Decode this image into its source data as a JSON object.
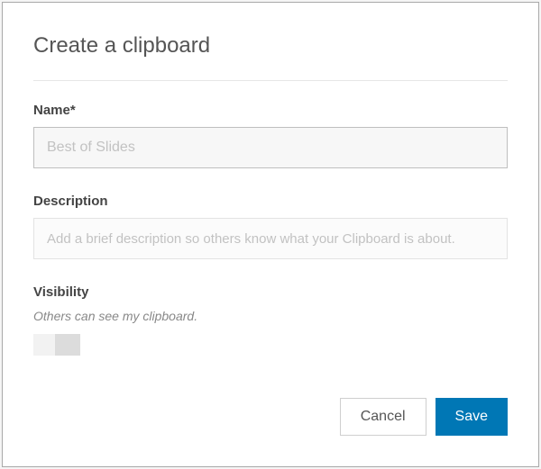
{
  "modal": {
    "title": "Create a clipboard",
    "fields": {
      "name": {
        "label": "Name*",
        "placeholder": "Best of Slides",
        "value": ""
      },
      "description": {
        "label": "Description",
        "placeholder": "Add a brief description so others know what your Clipboard is about.",
        "value": ""
      },
      "visibility": {
        "label": "Visibility",
        "hint": "Others can see my clipboard.",
        "enabled": false
      }
    },
    "buttons": {
      "cancel": "Cancel",
      "save": "Save"
    }
  }
}
